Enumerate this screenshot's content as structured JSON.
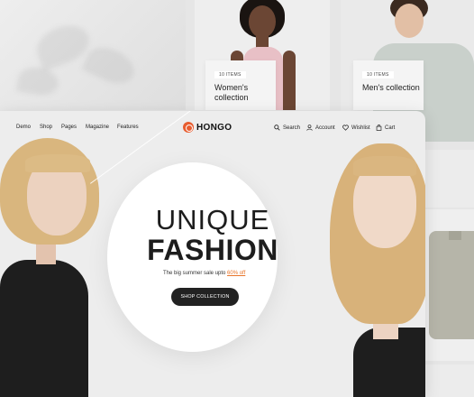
{
  "collections": {
    "women": {
      "badge": "10 ITEMS",
      "title": "Women's collection"
    },
    "men": {
      "badge": "10 ITEMS",
      "title": "Men's collection"
    }
  },
  "nav": {
    "left": [
      "Demo",
      "Shop",
      "Pages",
      "Magazine",
      "Features"
    ],
    "brand": "HONGO",
    "search": "Search",
    "account": "Account",
    "wishlist": "Wishlist",
    "cart": "Cart"
  },
  "hero": {
    "line1": "UNIQUE",
    "line2": "FASHION",
    "subtitle_prefix": "The big summer sale upto",
    "subtitle_highlight": "60% off",
    "cta": "SHOP COLLECTION"
  },
  "colors": {
    "accent": "#e8752b",
    "brand_mark": "#e85d30",
    "dark": "#222222"
  }
}
